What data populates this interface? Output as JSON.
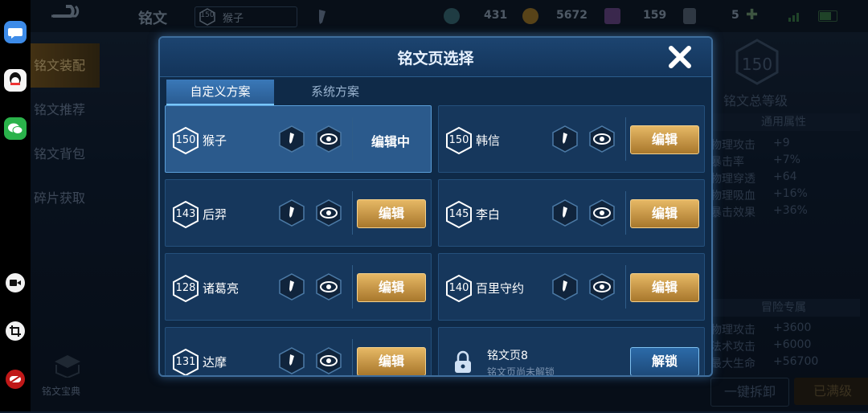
{
  "dock": {
    "apps": [
      "messages-app-icon",
      "qq-app-icon",
      "wechat-app-icon"
    ],
    "tools": [
      "screen-record-icon",
      "crop-icon",
      "game-mode-icon"
    ]
  },
  "topbar": {
    "title": "铭文",
    "current_level": "150",
    "current_plan": "猴子",
    "resources": [
      {
        "icon": "gem-icon",
        "value": "431"
      },
      {
        "icon": "gold-coin-icon",
        "value": "5672"
      },
      {
        "icon": "purple-crystal-icon",
        "value": "159"
      },
      {
        "icon": "card-icon",
        "value": "5"
      }
    ]
  },
  "leftnav": {
    "items": [
      "铭文装配",
      "铭文推荐",
      "铭文背包",
      "碎片获取"
    ],
    "bottom": "铭文宝典"
  },
  "rightpanel": {
    "total_level": "150",
    "total_level_label": "铭文总等级",
    "general_title": "通用属性",
    "general_stats": [
      {
        "name": "物理攻击",
        "value": "+9"
      },
      {
        "name": "暴击率",
        "value": "+7%"
      },
      {
        "name": "物理穿透",
        "value": "+64"
      },
      {
        "name": "物理吸血",
        "value": "+16%"
      },
      {
        "name": "暴击效果",
        "value": "+36%"
      }
    ],
    "adventure_title": "冒险专属",
    "adventure_stats": [
      {
        "name": "物理攻击",
        "value": "+3600"
      },
      {
        "name": "法术攻击",
        "value": "+6000"
      },
      {
        "name": "最大生命",
        "value": "+56700"
      }
    ],
    "btn_unequip": "一键拆卸",
    "btn_maxed": "已满级"
  },
  "modal": {
    "title": "铭文页选择",
    "tabs": [
      "自定义方案",
      "系统方案"
    ],
    "edit_label": "编辑",
    "editing_label": "编辑中",
    "pages": [
      {
        "level": "150",
        "hero": "猴子"
      },
      {
        "level": "150",
        "hero": "韩信"
      },
      {
        "level": "143",
        "hero": "后羿"
      },
      {
        "level": "145",
        "hero": "李白"
      },
      {
        "level": "128",
        "hero": "诸葛亮"
      },
      {
        "level": "140",
        "hero": "百里守约"
      },
      {
        "level": "131",
        "hero": "达摩"
      }
    ],
    "locked_page": {
      "name": "铭文页8",
      "sub": "铭文页尚未解锁",
      "button": "解锁"
    }
  },
  "colors": {
    "gold": "#e6b865",
    "panel": "#16375c",
    "selected": "#2b5a8c"
  }
}
